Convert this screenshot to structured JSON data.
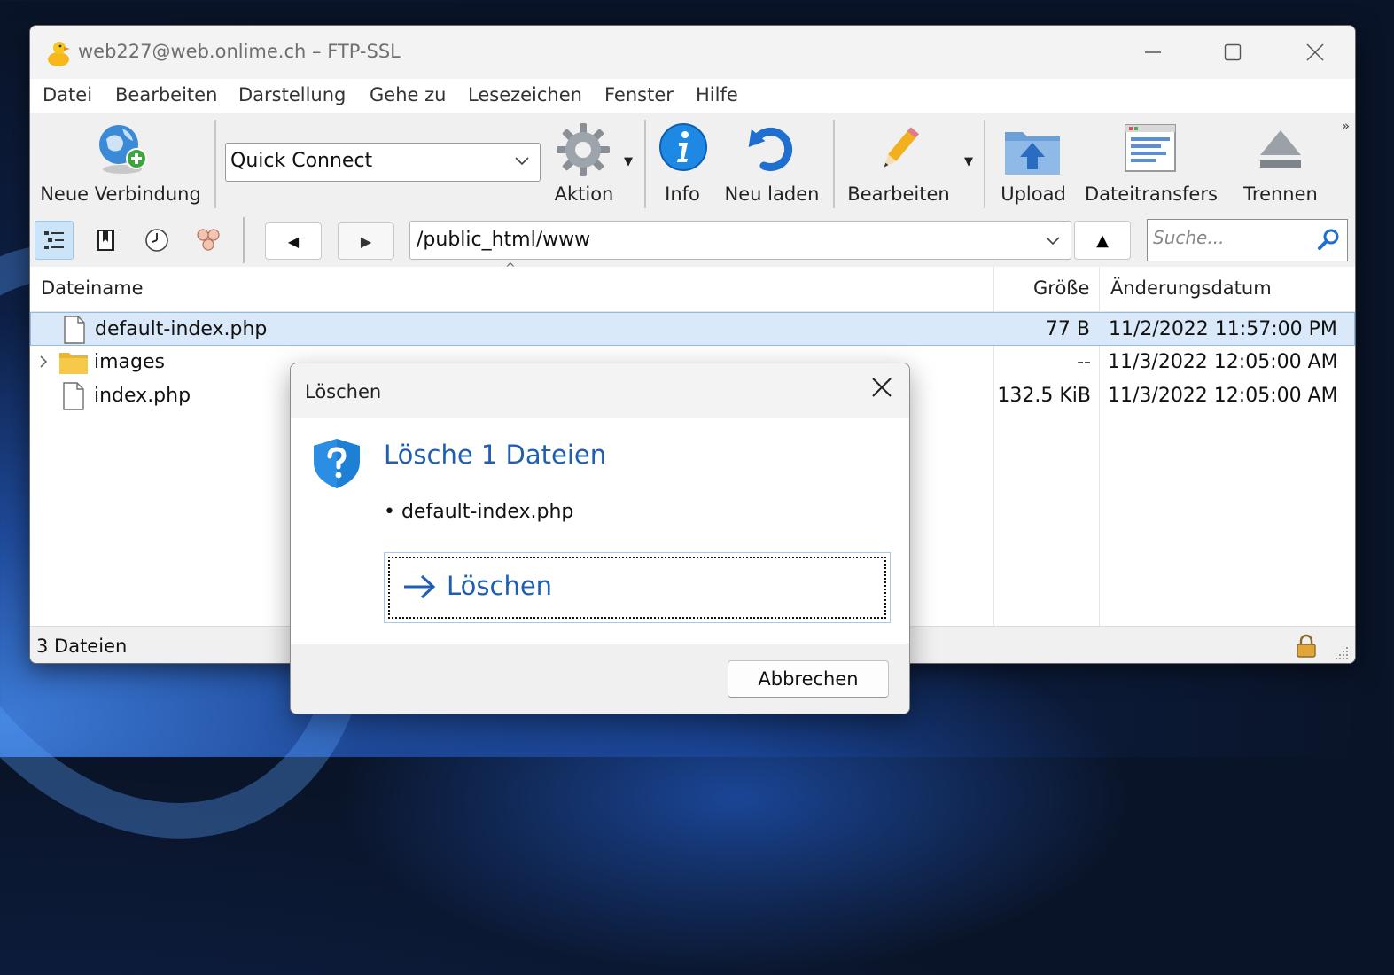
{
  "window": {
    "title": "web227@web.onlime.ch – FTP-SSL",
    "controls": {
      "minimize": "─",
      "maximize": "☐",
      "close": "✕"
    }
  },
  "menu": [
    "Datei",
    "Bearbeiten",
    "Darstellung",
    "Gehe zu",
    "Lesezeichen",
    "Fenster",
    "Hilfe"
  ],
  "toolbar": {
    "new_connection": "Neue Verbindung",
    "quick_connect": "Quick Connect",
    "action": "Aktion",
    "info": "Info",
    "reload": "Neu laden",
    "edit": "Bearbeiten",
    "upload": "Upload",
    "transfers": "Dateitransfers",
    "disconnect": "Trennen",
    "overflow": "»"
  },
  "navigation": {
    "back": "◀",
    "forward": "▶",
    "path": "/public_html/www",
    "up": "▲",
    "search_placeholder": "Suche..."
  },
  "columns": {
    "name": "Dateiname",
    "size": "Größe",
    "modified": "Änderungsdatum"
  },
  "files": [
    {
      "name": "default-index.php",
      "size": "77 B",
      "modified": "11/2/2022 11:57:00 PM",
      "type": "file",
      "selected": true
    },
    {
      "name": "images",
      "size": "--",
      "modified": "11/3/2022 12:05:00 AM",
      "type": "folder",
      "selected": false
    },
    {
      "name": "index.php",
      "size": "132.5 KiB",
      "modified": "11/3/2022 12:05:00 AM",
      "type": "file",
      "selected": false
    }
  ],
  "status": {
    "text": "3 Dateien"
  },
  "dialog": {
    "title": "Löschen",
    "heading": "Lösche 1 Dateien",
    "items": [
      "• default-index.php"
    ],
    "command_label": "Löschen",
    "cancel_label": "Abbrechen"
  },
  "colors": {
    "accent_blue": "#1e5fb4",
    "selection": "#d9e9f9",
    "folder": "#f7c948"
  }
}
